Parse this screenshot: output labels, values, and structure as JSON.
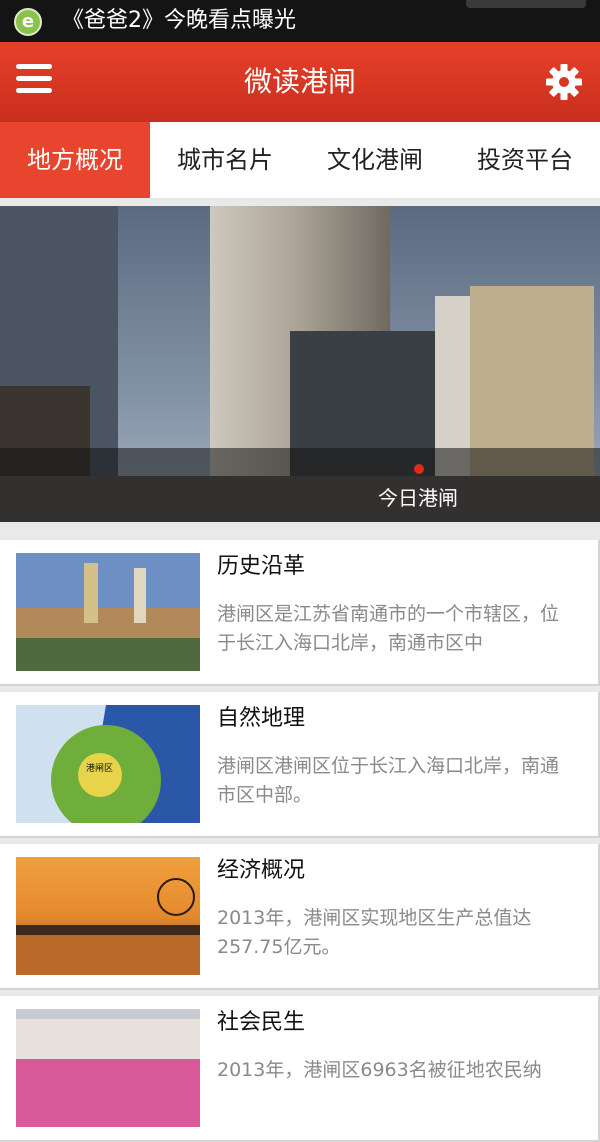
{
  "status_bar": {
    "notification_text": "《爸爸2》今晚看点曝光",
    "app_logo_glyph": "e"
  },
  "header": {
    "title": "微读港闸",
    "menu_icon": "hamburger-menu-icon",
    "settings_icon": "gear-icon",
    "accent_color": "#e6402a"
  },
  "tabs": [
    {
      "label": "地方概况",
      "active": true
    },
    {
      "label": "城市名片",
      "active": false
    },
    {
      "label": "文化港闸",
      "active": false
    },
    {
      "label": "投资平台",
      "active": false
    }
  ],
  "banner": {
    "caption": "今日港闸"
  },
  "news": [
    {
      "title": "历史沿革",
      "summary": "港闸区是江苏省南通市的一个市辖区，位于长江入海口北岸，南通市区中"
    },
    {
      "title": "自然地理",
      "summary": "港闸区港闸区位于长江入海口北岸，南通市区中部。",
      "map_label": "港闸区"
    },
    {
      "title": "经济概况",
      "summary": "2013年，港闸区实现地区生产总值达257.75亿元。"
    },
    {
      "title": "社会民生",
      "summary": "2013年，港闸区6963名被征地农民纳"
    }
  ]
}
